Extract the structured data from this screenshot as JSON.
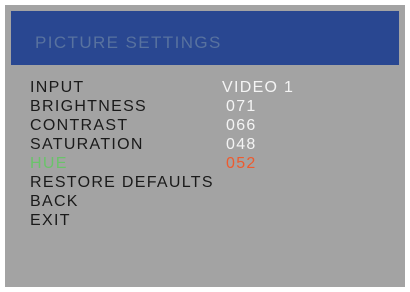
{
  "header": {
    "title": "PICTURE SETTINGS"
  },
  "menu": {
    "items": [
      {
        "label": "INPUT",
        "value": "VIDEO 1"
      },
      {
        "label": "BRIGHTNESS",
        "value": "071"
      },
      {
        "label": "CONTRAST",
        "value": "066"
      },
      {
        "label": "SATURATION",
        "value": "048"
      },
      {
        "label": "HUE",
        "value": "052",
        "selected": true
      },
      {
        "label": "RESTORE DEFAULTS"
      },
      {
        "label": "BACK"
      },
      {
        "label": "EXIT"
      }
    ]
  },
  "colors": {
    "panel_background": "#a3a3a3",
    "header_background": "#294791",
    "title_text": "#58729f",
    "label_text": "#1a1a1a",
    "value_text": "#f4f4f4",
    "selected_label": "#6ac36a",
    "selected_value": "#ee5b2f"
  }
}
